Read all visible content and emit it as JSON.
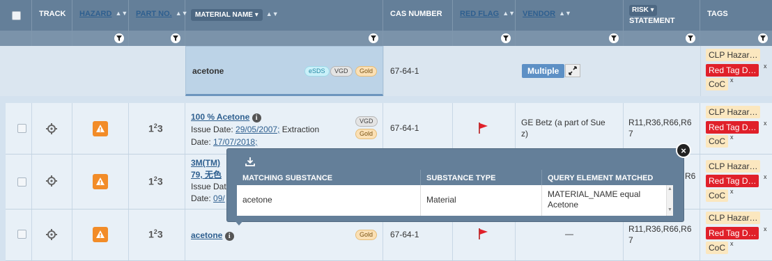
{
  "header": {
    "track": "TRACK",
    "hazard": "HAZARD",
    "part_no": "PART NO.",
    "material_name": "MATERIAL NAME",
    "cas_number": "CAS NUMBER",
    "red_flag": "RED FLAG",
    "vendor": "VENDOR",
    "risk_statement_1": "RISK",
    "risk_statement_2": "STATEMENT",
    "tags": "TAGS"
  },
  "group": {
    "material": "acetone",
    "badges": [
      "eSDS",
      "VGD",
      "Gold"
    ],
    "cas": "67-64-1",
    "vendor_multiple": "Multiple",
    "tags": [
      "CLP Hazar…",
      "Red Tag D…",
      "CoC"
    ]
  },
  "rows": [
    {
      "material": "100 % Acetone",
      "issue_label": "Issue Date:",
      "issue_date": "29/05/2007;",
      "extraction_label": "Extraction",
      "date_label": "Date:",
      "extraction_date": "17/07/2018;",
      "badges": [
        "VGD",
        "Gold"
      ],
      "cas": "67-64-1",
      "vendor": "GE Betz (a part of Suez)",
      "vendor_line1": "GE Betz (a part of Sue",
      "vendor_line2": "z)",
      "risk_line1": "R11,R36,R66,R6",
      "risk_line2": "7",
      "tags": [
        "CLP Hazar…",
        "Red Tag D…",
        "CoC"
      ]
    },
    {
      "material_line1": "3M(TM)",
      "material_line2": "79, 无色",
      "issue_label": "Issue Dat",
      "date_label": "Date:",
      "date_partial": "09/",
      "risk_partial": "R6",
      "tags": [
        "CLP Hazar…",
        "Red Tag D…",
        "CoC"
      ]
    },
    {
      "material": "acetone",
      "badges": [
        "Gold"
      ],
      "cas": "67-64-1",
      "vendor": "—",
      "risk_line1": "R11,R36,R66,R6",
      "risk_line2": "7",
      "tags": [
        "CLP Hazar…",
        "Red Tag D…",
        "CoC"
      ]
    }
  ],
  "popup": {
    "col1": "MATCHING SUBSTANCE",
    "col2": "SUBSTANCE TYPE",
    "col3": "QUERY ELEMENT MATCHED",
    "substance": "acetone",
    "type": "Material",
    "query_line1": "MATERIAL_NAME equal",
    "query_line2": "Acetone"
  },
  "tag_close": "x",
  "close_symbol": "×",
  "colors": {
    "header": "#647f99",
    "red_tag": "#e0202a",
    "warning": "#f28c28",
    "multiple": "#5d90c5",
    "link": "#2e5f8f"
  },
  "icons": [
    "checkbox",
    "filter-funnel-icon",
    "target-icon",
    "warning-icon",
    "number-icon",
    "info-icon",
    "red-flag-icon",
    "expand-icon",
    "download-icon",
    "close-icon"
  ]
}
